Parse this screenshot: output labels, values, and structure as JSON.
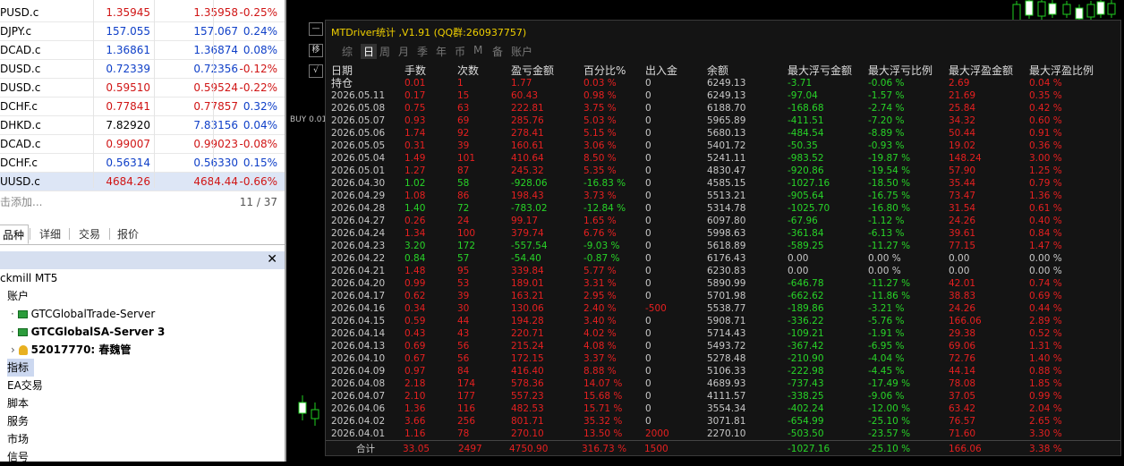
{
  "market_watch": {
    "rows": [
      {
        "symbol": "PUSD.c",
        "bid": "1.35945",
        "ask": "1.35958",
        "change": "-0.25%",
        "bid_color": "#d01515",
        "ask_color": "#d01515",
        "chg_color": "#d01515"
      },
      {
        "symbol": "DJPY.c",
        "bid": "157.055",
        "ask": "157.067",
        "change": "0.24%",
        "bid_color": "#1040c8",
        "ask_color": "#1040c8",
        "chg_color": "#1040c8"
      },
      {
        "symbol": "DCAD.c",
        "bid": "1.36861",
        "ask": "1.36874",
        "change": "0.08%",
        "bid_color": "#1040c8",
        "ask_color": "#1040c8",
        "chg_color": "#1040c8"
      },
      {
        "symbol": "DUSD.c",
        "bid": "0.72339",
        "ask": "0.72356",
        "change": "-0.12%",
        "bid_color": "#1040c8",
        "ask_color": "#1040c8",
        "chg_color": "#d01515"
      },
      {
        "symbol": "DUSD.c",
        "bid": "0.59510",
        "ask": "0.59524",
        "change": "-0.22%",
        "bid_color": "#d01515",
        "ask_color": "#d01515",
        "chg_color": "#d01515"
      },
      {
        "symbol": "DCHF.c",
        "bid": "0.77841",
        "ask": "0.77857",
        "change": "0.32%",
        "bid_color": "#d01515",
        "ask_color": "#d01515",
        "chg_color": "#1040c8"
      },
      {
        "symbol": "DHKD.c",
        "bid": "7.82920",
        "ask": "7.83156",
        "change": "0.04%",
        "bid_color": "#000000",
        "ask_color": "#1040c8",
        "chg_color": "#1040c8"
      },
      {
        "symbol": "DCAD.c",
        "bid": "0.99007",
        "ask": "0.99023",
        "change": "-0.08%",
        "bid_color": "#d01515",
        "ask_color": "#d01515",
        "chg_color": "#d01515"
      },
      {
        "symbol": "DCHF.c",
        "bid": "0.56314",
        "ask": "0.56330",
        "change": "0.15%",
        "bid_color": "#1040c8",
        "ask_color": "#1040c8",
        "chg_color": "#1040c8"
      },
      {
        "symbol": "UUSD.c",
        "bid": "4684.26",
        "ask": "4684.44",
        "change": "-0.66%",
        "bid_color": "#d01515",
        "ask_color": "#d01515",
        "chg_color": "#d01515"
      }
    ],
    "add_text": "击添加...",
    "count": "11 / 37",
    "tabs": [
      "品种",
      "详细",
      "交易",
      "报价"
    ]
  },
  "navigator": {
    "items": [
      {
        "text": "ckmill MT5",
        "indent": 0,
        "bold": false,
        "icon": ""
      },
      {
        "text": "账户",
        "indent": 1,
        "bold": false,
        "icon": ""
      },
      {
        "text": "GTCGlobalTrade-Server",
        "indent": 2,
        "bold": false,
        "icon": "server-icon"
      },
      {
        "text": "GTCGlobalSA-Server 3",
        "indent": 2,
        "bold": true,
        "icon": "server-icon"
      },
      {
        "text": "52017770: 春魏管",
        "indent": 3,
        "bold": true,
        "icon": "user-icon"
      },
      {
        "text": "指标",
        "indent": 1,
        "bold": false,
        "icon": ""
      },
      {
        "text": "EA交易",
        "indent": 1,
        "bold": false,
        "icon": ""
      },
      {
        "text": "脚本",
        "indent": 1,
        "bold": false,
        "icon": ""
      },
      {
        "text": "服务",
        "indent": 1,
        "bold": false,
        "icon": ""
      },
      {
        "text": "市场",
        "indent": 1,
        "bold": false,
        "icon": ""
      },
      {
        "text": "信号",
        "indent": 1,
        "bold": false,
        "icon": ""
      }
    ]
  },
  "chart": {
    "buy_tag": "BUY 0.01"
  },
  "panel": {
    "title": "MTDriver统计 ,V1.91 (QQ群:260937757)",
    "tabs": [
      "综",
      "日",
      "周",
      "月",
      "季",
      "年",
      "币",
      "M",
      "备",
      "账户"
    ],
    "active_tab": "日",
    "side_buttons": [
      "—",
      "移",
      "√"
    ],
    "headers": [
      "日期",
      "手数",
      "次数",
      "盈亏金额",
      "百分比%",
      "出入金",
      "余额",
      "最大浮亏金额",
      "最大浮亏比例",
      "最大浮盈金额",
      "最大浮盈比例"
    ],
    "hold_label": "持仓",
    "colors": {
      "gray": "#c8c8c8",
      "red": "#e62020",
      "green": "#28d428",
      "title": "#f0d000"
    },
    "rows": [
      [
        "",
        "0.01",
        "1",
        "1.77",
        "0.03 %",
        "0",
        "6249.13",
        "-3.71",
        "-0.06 %",
        "2.69",
        "0.04 %",
        "r"
      ],
      [
        "2026.05.11",
        "0.17",
        "15",
        "60.43",
        "0.98 %",
        "0",
        "6249.13",
        "-97.04",
        "-1.57 %",
        "21.69",
        "0.35 %",
        "r"
      ],
      [
        "2026.05.08",
        "0.75",
        "63",
        "222.81",
        "3.75 %",
        "0",
        "6188.70",
        "-168.68",
        "-2.74 %",
        "25.84",
        "0.42 %",
        "r"
      ],
      [
        "2026.05.07",
        "0.93",
        "69",
        "285.76",
        "5.03 %",
        "0",
        "5965.89",
        "-411.51",
        "-7.20 %",
        "34.32",
        "0.60 %",
        "r"
      ],
      [
        "2026.05.06",
        "1.74",
        "92",
        "278.41",
        "5.15 %",
        "0",
        "5680.13",
        "-484.54",
        "-8.89 %",
        "50.44",
        "0.91 %",
        "r"
      ],
      [
        "2026.05.05",
        "0.31",
        "39",
        "160.61",
        "3.06 %",
        "0",
        "5401.72",
        "-50.35",
        "-0.93 %",
        "19.02",
        "0.36 %",
        "r"
      ],
      [
        "2026.05.04",
        "1.49",
        "101",
        "410.64",
        "8.50 %",
        "0",
        "5241.11",
        "-983.52",
        "-19.87 %",
        "148.24",
        "3.00 %",
        "r"
      ],
      [
        "2026.05.01",
        "1.27",
        "87",
        "245.32",
        "5.35 %",
        "0",
        "4830.47",
        "-920.86",
        "-19.54 %",
        "57.90",
        "1.25 %",
        "r"
      ],
      [
        "2026.04.30",
        "1.02",
        "58",
        "-928.06",
        "-16.83 %",
        "0",
        "4585.15",
        "-1027.16",
        "-18.50 %",
        "35.44",
        "0.79 %",
        "g"
      ],
      [
        "2026.04.29",
        "1.08",
        "86",
        "198.43",
        "3.73 %",
        "0",
        "5513.21",
        "-905.64",
        "-16.75 %",
        "73.47",
        "1.36 %",
        "r"
      ],
      [
        "2026.04.28",
        "1.40",
        "72",
        "-783.02",
        "-12.84 %",
        "0",
        "5314.78",
        "-1025.70",
        "-16.80 %",
        "31.54",
        "0.61 %",
        "g"
      ],
      [
        "2026.04.27",
        "0.26",
        "24",
        "99.17",
        "1.65 %",
        "0",
        "6097.80",
        "-67.96",
        "-1.12 %",
        "24.26",
        "0.40 %",
        "r"
      ],
      [
        "2026.04.24",
        "1.34",
        "100",
        "379.74",
        "6.76 %",
        "0",
        "5998.63",
        "-361.84",
        "-6.13 %",
        "39.61",
        "0.84 %",
        "r"
      ],
      [
        "2026.04.23",
        "3.20",
        "172",
        "-557.54",
        "-9.03 %",
        "0",
        "5618.89",
        "-589.25",
        "-11.27 %",
        "77.15",
        "1.47 %",
        "g"
      ],
      [
        "2026.04.22",
        "0.84",
        "57",
        "-54.40",
        "-0.87 %",
        "0",
        "6176.43",
        "0.00",
        "0.00 %",
        "0.00",
        "0.00 %",
        "g"
      ],
      [
        "2026.04.21",
        "1.48",
        "95",
        "339.84",
        "5.77 %",
        "0",
        "6230.83",
        "0.00",
        "0.00 %",
        "0.00",
        "0.00 %",
        "r"
      ],
      [
        "2026.04.20",
        "0.99",
        "53",
        "189.01",
        "3.31 %",
        "0",
        "5890.99",
        "-646.78",
        "-11.27 %",
        "42.01",
        "0.74 %",
        "r"
      ],
      [
        "2026.04.17",
        "0.62",
        "39",
        "163.21",
        "2.95 %",
        "0",
        "5701.98",
        "-662.62",
        "-11.86 %",
        "38.83",
        "0.69 %",
        "r"
      ],
      [
        "2026.04.16",
        "0.34",
        "30",
        "130.06",
        "2.40 %",
        "-500",
        "5538.77",
        "-189.86",
        "-3.21 %",
        "24.26",
        "0.44 %",
        "r"
      ],
      [
        "2026.04.15",
        "0.59",
        "44",
        "194.28",
        "3.40 %",
        "0",
        "5908.71",
        "-336.22",
        "-5.76 %",
        "166.06",
        "2.89 %",
        "r"
      ],
      [
        "2026.04.14",
        "0.43",
        "43",
        "220.71",
        "4.02 %",
        "0",
        "5714.43",
        "-109.21",
        "-1.91 %",
        "29.38",
        "0.52 %",
        "r"
      ],
      [
        "2026.04.13",
        "0.69",
        "56",
        "215.24",
        "4.08 %",
        "0",
        "5493.72",
        "-367.42",
        "-6.95 %",
        "69.06",
        "1.31 %",
        "r"
      ],
      [
        "2026.04.10",
        "0.67",
        "56",
        "172.15",
        "3.37 %",
        "0",
        "5278.48",
        "-210.90",
        "-4.04 %",
        "72.76",
        "1.40 %",
        "r"
      ],
      [
        "2026.04.09",
        "0.97",
        "84",
        "416.40",
        "8.88 %",
        "0",
        "5106.33",
        "-222.98",
        "-4.45 %",
        "44.14",
        "0.88 %",
        "r"
      ],
      [
        "2026.04.08",
        "2.18",
        "174",
        "578.36",
        "14.07 %",
        "0",
        "4689.93",
        "-737.43",
        "-17.49 %",
        "78.08",
        "1.85 %",
        "r"
      ],
      [
        "2026.04.07",
        "2.10",
        "177",
        "557.23",
        "15.68 %",
        "0",
        "4111.57",
        "-338.25",
        "-9.06 %",
        "37.05",
        "0.99 %",
        "r"
      ],
      [
        "2026.04.06",
        "1.36",
        "116",
        "482.53",
        "15.71 %",
        "0",
        "3554.34",
        "-402.24",
        "-12.00 %",
        "63.42",
        "2.04 %",
        "r"
      ],
      [
        "2026.04.02",
        "3.66",
        "256",
        "801.71",
        "35.32 %",
        "0",
        "3071.81",
        "-654.99",
        "-25.10 %",
        "76.57",
        "2.65 %",
        "r"
      ],
      [
        "2026.04.01",
        "1.16",
        "78",
        "270.10",
        "13.50 %",
        "2000",
        "2270.10",
        "-503.50",
        "-23.57 %",
        "71.60",
        "3.30 %",
        "r"
      ]
    ],
    "total": {
      "label": "合计",
      "lots": "33.05",
      "count": "2497",
      "pnl": "4750.90",
      "pct": "316.73 %",
      "deposit": "1500",
      "max_dd": "-1027.16",
      "max_dd_pct": "-25.10 %",
      "max_up": "166.06",
      "max_up_pct": "3.38 %"
    }
  }
}
